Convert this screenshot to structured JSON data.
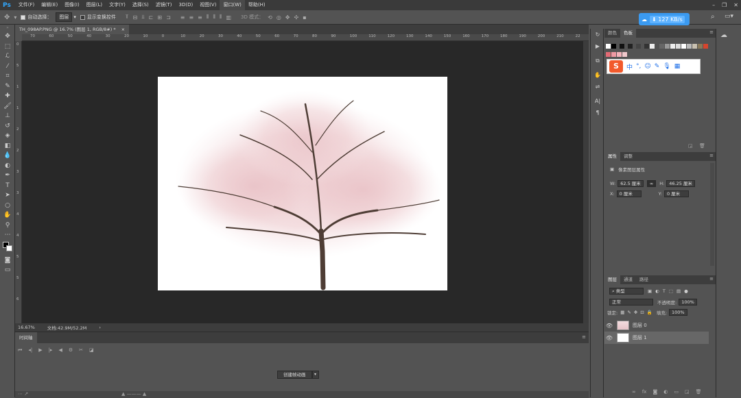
{
  "app": {
    "logo": "Ps"
  },
  "menu": [
    "文件(F)",
    "编辑(E)",
    "图像(I)",
    "图层(L)",
    "文字(Y)",
    "选择(S)",
    "滤镜(T)",
    "3D(D)",
    "视图(V)",
    "窗口(W)",
    "帮助(H)"
  ],
  "options_bar": {
    "auto_select_label": "自动选择：",
    "auto_select_value": "图层",
    "transform_controls_label": "显示变换控件",
    "mode_3d_label": "3D 模式："
  },
  "net_speed": "127 KB/s",
  "document_tab": {
    "title": "TH_098AP.PNG @ 16.7% (图层 1, RGB/8#) *",
    "close": "×"
  },
  "ruler_top_ticks": [
    "70",
    "60",
    "50",
    "40",
    "30",
    "20",
    "10",
    "0",
    "10",
    "20",
    "30",
    "40",
    "50",
    "60",
    "70",
    "80",
    "90",
    "100",
    "110",
    "120",
    "130",
    "140",
    "150",
    "160",
    "170",
    "180",
    "190",
    "200",
    "210",
    "22"
  ],
  "ruler_left_ticks": [
    "0",
    "5",
    "1",
    "1",
    "2",
    "2",
    "3",
    "3",
    "4",
    "4",
    "5",
    "5",
    "6"
  ],
  "status_bar": {
    "zoom": "16.67%",
    "doc_info": "文档:42.9M/52.2M",
    "arrow": "›"
  },
  "timeline": {
    "tab": "时间轴",
    "create_button": "创建帧动画"
  },
  "right_panels": {
    "swatch_tabs": [
      "颜色",
      "色板"
    ],
    "props_tabs": [
      "属性",
      "调整"
    ],
    "props_title": "像素图层属性",
    "w_label": "W:",
    "w_value": "62.5 厘米",
    "h_label": "H:",
    "h_value": "46.25 厘米",
    "x_label": "X:",
    "x_value": "0 厘米",
    "y_label": "Y:",
    "y_value": "0 厘米",
    "layers_tabs": [
      "图层",
      "通道",
      "路径"
    ],
    "filter_kind": "类型",
    "blend_mode": "正常",
    "opacity_label": "不透明度:",
    "opacity_value": "100%",
    "lock_label": "锁定:",
    "fill_label": "填充:",
    "fill_value": "100%",
    "layers": [
      {
        "name": "图层 0"
      },
      {
        "name": "图层 1"
      }
    ]
  },
  "ime": {
    "logo": "S",
    "lang": "中"
  },
  "colors": {
    "accent_blue": "#3b9af0",
    "ime_orange": "#f25a2c",
    "selected_layer": "#676767"
  }
}
